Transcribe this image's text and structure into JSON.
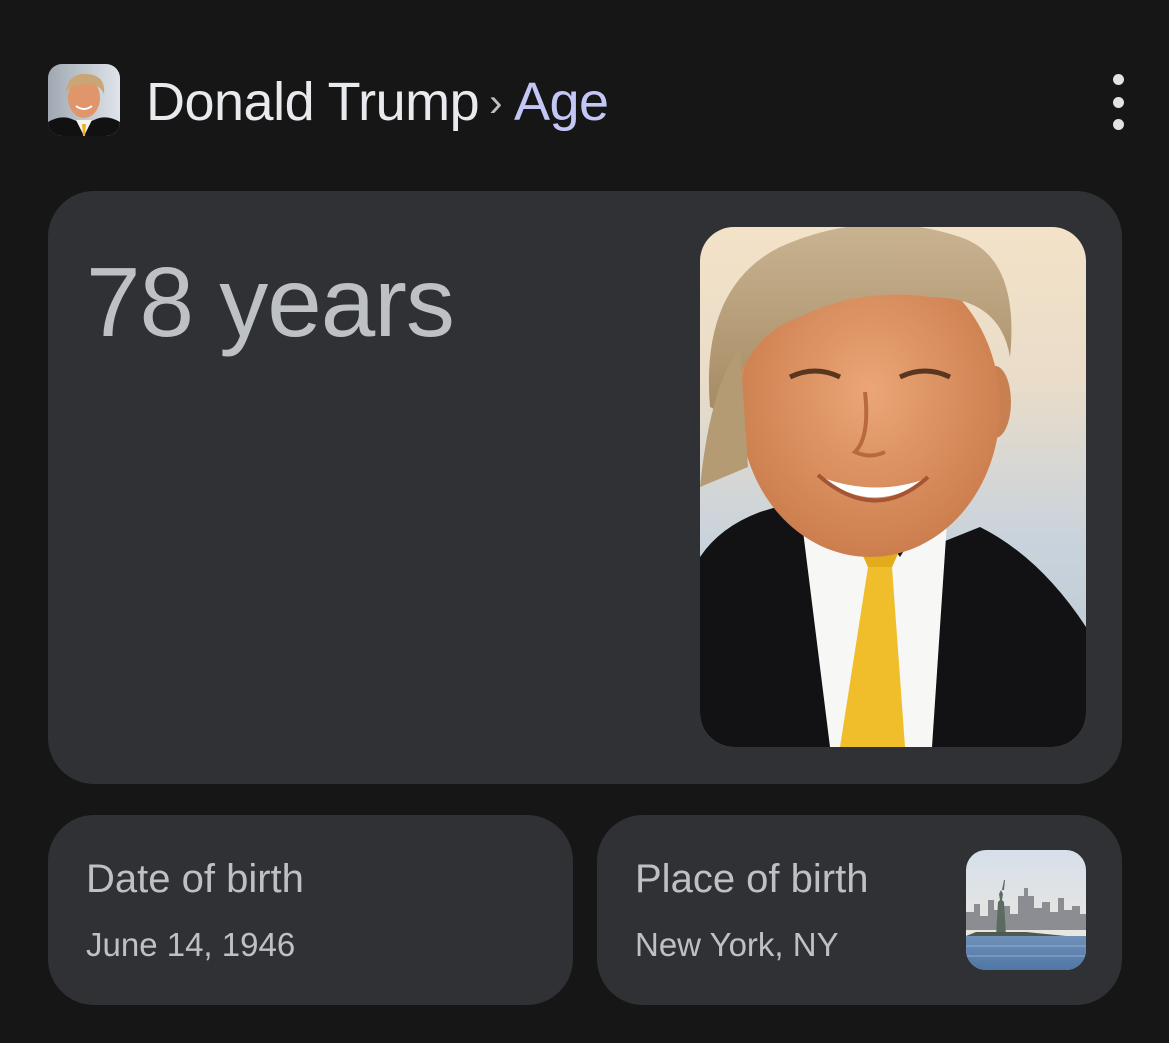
{
  "header": {
    "entity": "Donald Trump",
    "separator": "›",
    "attribute": "Age",
    "avatar_icon": "person-photo",
    "menu_icon": "more-vert-icon"
  },
  "main_card": {
    "age": "78 years",
    "portrait_icon": "person-portrait-photo"
  },
  "facts": {
    "date_of_birth": {
      "label": "Date of birth",
      "value": "June 14, 1946"
    },
    "place_of_birth": {
      "label": "Place of birth",
      "value": "New York, NY",
      "thumb_icon": "new-york-skyline-photo"
    }
  },
  "colors": {
    "background": "#161617",
    "card": "#303134",
    "text_primary": "#e8eaed",
    "text_secondary": "#bdc1c6",
    "crumb_accent": "#c4c7f5"
  }
}
